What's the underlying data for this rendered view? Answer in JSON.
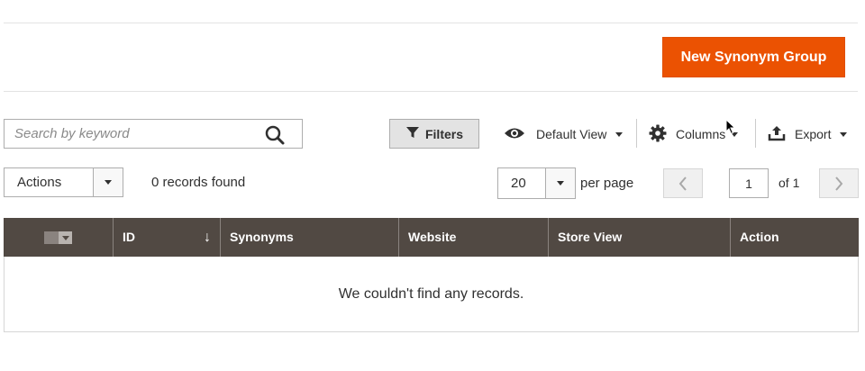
{
  "header": {
    "primary_button": "New Synonym Group"
  },
  "toolbar": {
    "search_placeholder": "Search by keyword",
    "filters_label": "Filters",
    "view_label": "Default View",
    "columns_label": "Columns",
    "export_label": "Export"
  },
  "listing": {
    "actions_label": "Actions",
    "records_found": "0 records found",
    "per_page_value": "20",
    "per_page_label": "per page",
    "current_page": "1",
    "page_total": "of 1"
  },
  "table": {
    "columns": [
      "ID",
      "Synonyms",
      "Website",
      "Store View",
      "Action"
    ],
    "sort_indicator": "↓",
    "empty_message": "We couldn't find any records."
  },
  "colors": {
    "accent": "#eb5202",
    "header_bg": "#514943"
  }
}
